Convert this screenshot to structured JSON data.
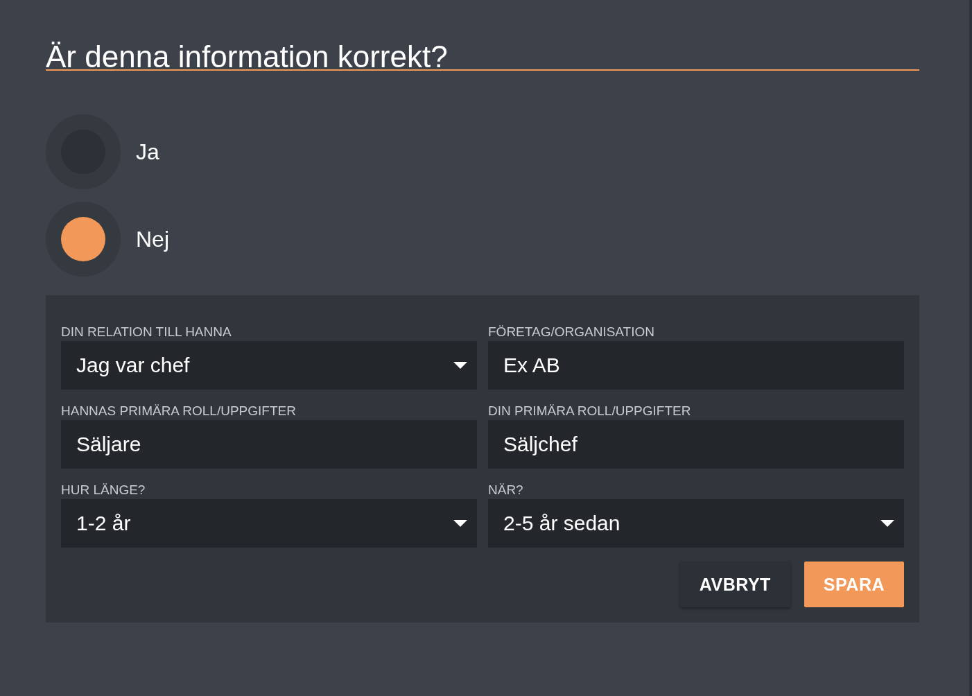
{
  "title": "Är denna information korrekt?",
  "options": [
    {
      "label": "Ja",
      "selected": false
    },
    {
      "label": "Nej",
      "selected": true
    }
  ],
  "fields": [
    {
      "label": "DIN RELATION TILL HANNA",
      "value": "Jag var chef",
      "kind": "select"
    },
    {
      "label": "FÖRETAG/ORGANISATION",
      "value": "Ex AB",
      "kind": "text"
    },
    {
      "label": "HANNAS PRIMÄRA ROLL/UPPGIFTER",
      "value": "Säljare",
      "kind": "text"
    },
    {
      "label": "DIN PRIMÄRA ROLL/UPPGIFTER",
      "value": "Säljchef",
      "kind": "text"
    },
    {
      "label": "HUR LÄNGE?",
      "value": "1-2 år",
      "kind": "select"
    },
    {
      "label": "NÄR?",
      "value": "2-5 år sedan",
      "kind": "select"
    }
  ],
  "buttons": [
    {
      "label": "AVBRYT",
      "kind": "secondary"
    },
    {
      "label": "SPARA",
      "kind": "primary"
    }
  ]
}
